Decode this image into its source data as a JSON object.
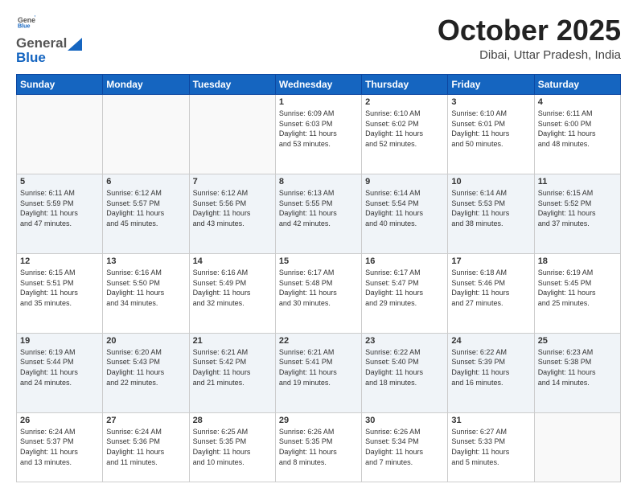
{
  "header": {
    "logo_general": "General",
    "logo_blue": "Blue",
    "month_title": "October 2025",
    "location": "Dibai, Uttar Pradesh, India"
  },
  "days_of_week": [
    "Sunday",
    "Monday",
    "Tuesday",
    "Wednesday",
    "Thursday",
    "Friday",
    "Saturday"
  ],
  "weeks": [
    {
      "alt": false,
      "cells": [
        {
          "day": "",
          "info": ""
        },
        {
          "day": "",
          "info": ""
        },
        {
          "day": "",
          "info": ""
        },
        {
          "day": "1",
          "info": "Sunrise: 6:09 AM\nSunset: 6:03 PM\nDaylight: 11 hours\nand 53 minutes."
        },
        {
          "day": "2",
          "info": "Sunrise: 6:10 AM\nSunset: 6:02 PM\nDaylight: 11 hours\nand 52 minutes."
        },
        {
          "day": "3",
          "info": "Sunrise: 6:10 AM\nSunset: 6:01 PM\nDaylight: 11 hours\nand 50 minutes."
        },
        {
          "day": "4",
          "info": "Sunrise: 6:11 AM\nSunset: 6:00 PM\nDaylight: 11 hours\nand 48 minutes."
        }
      ]
    },
    {
      "alt": true,
      "cells": [
        {
          "day": "5",
          "info": "Sunrise: 6:11 AM\nSunset: 5:59 PM\nDaylight: 11 hours\nand 47 minutes."
        },
        {
          "day": "6",
          "info": "Sunrise: 6:12 AM\nSunset: 5:57 PM\nDaylight: 11 hours\nand 45 minutes."
        },
        {
          "day": "7",
          "info": "Sunrise: 6:12 AM\nSunset: 5:56 PM\nDaylight: 11 hours\nand 43 minutes."
        },
        {
          "day": "8",
          "info": "Sunrise: 6:13 AM\nSunset: 5:55 PM\nDaylight: 11 hours\nand 42 minutes."
        },
        {
          "day": "9",
          "info": "Sunrise: 6:14 AM\nSunset: 5:54 PM\nDaylight: 11 hours\nand 40 minutes."
        },
        {
          "day": "10",
          "info": "Sunrise: 6:14 AM\nSunset: 5:53 PM\nDaylight: 11 hours\nand 38 minutes."
        },
        {
          "day": "11",
          "info": "Sunrise: 6:15 AM\nSunset: 5:52 PM\nDaylight: 11 hours\nand 37 minutes."
        }
      ]
    },
    {
      "alt": false,
      "cells": [
        {
          "day": "12",
          "info": "Sunrise: 6:15 AM\nSunset: 5:51 PM\nDaylight: 11 hours\nand 35 minutes."
        },
        {
          "day": "13",
          "info": "Sunrise: 6:16 AM\nSunset: 5:50 PM\nDaylight: 11 hours\nand 34 minutes."
        },
        {
          "day": "14",
          "info": "Sunrise: 6:16 AM\nSunset: 5:49 PM\nDaylight: 11 hours\nand 32 minutes."
        },
        {
          "day": "15",
          "info": "Sunrise: 6:17 AM\nSunset: 5:48 PM\nDaylight: 11 hours\nand 30 minutes."
        },
        {
          "day": "16",
          "info": "Sunrise: 6:17 AM\nSunset: 5:47 PM\nDaylight: 11 hours\nand 29 minutes."
        },
        {
          "day": "17",
          "info": "Sunrise: 6:18 AM\nSunset: 5:46 PM\nDaylight: 11 hours\nand 27 minutes."
        },
        {
          "day": "18",
          "info": "Sunrise: 6:19 AM\nSunset: 5:45 PM\nDaylight: 11 hours\nand 25 minutes."
        }
      ]
    },
    {
      "alt": true,
      "cells": [
        {
          "day": "19",
          "info": "Sunrise: 6:19 AM\nSunset: 5:44 PM\nDaylight: 11 hours\nand 24 minutes."
        },
        {
          "day": "20",
          "info": "Sunrise: 6:20 AM\nSunset: 5:43 PM\nDaylight: 11 hours\nand 22 minutes."
        },
        {
          "day": "21",
          "info": "Sunrise: 6:21 AM\nSunset: 5:42 PM\nDaylight: 11 hours\nand 21 minutes."
        },
        {
          "day": "22",
          "info": "Sunrise: 6:21 AM\nSunset: 5:41 PM\nDaylight: 11 hours\nand 19 minutes."
        },
        {
          "day": "23",
          "info": "Sunrise: 6:22 AM\nSunset: 5:40 PM\nDaylight: 11 hours\nand 18 minutes."
        },
        {
          "day": "24",
          "info": "Sunrise: 6:22 AM\nSunset: 5:39 PM\nDaylight: 11 hours\nand 16 minutes."
        },
        {
          "day": "25",
          "info": "Sunrise: 6:23 AM\nSunset: 5:38 PM\nDaylight: 11 hours\nand 14 minutes."
        }
      ]
    },
    {
      "alt": false,
      "cells": [
        {
          "day": "26",
          "info": "Sunrise: 6:24 AM\nSunset: 5:37 PM\nDaylight: 11 hours\nand 13 minutes."
        },
        {
          "day": "27",
          "info": "Sunrise: 6:24 AM\nSunset: 5:36 PM\nDaylight: 11 hours\nand 11 minutes."
        },
        {
          "day": "28",
          "info": "Sunrise: 6:25 AM\nSunset: 5:35 PM\nDaylight: 11 hours\nand 10 minutes."
        },
        {
          "day": "29",
          "info": "Sunrise: 6:26 AM\nSunset: 5:35 PM\nDaylight: 11 hours\nand 8 minutes."
        },
        {
          "day": "30",
          "info": "Sunrise: 6:26 AM\nSunset: 5:34 PM\nDaylight: 11 hours\nand 7 minutes."
        },
        {
          "day": "31",
          "info": "Sunrise: 6:27 AM\nSunset: 5:33 PM\nDaylight: 11 hours\nand 5 minutes."
        },
        {
          "day": "",
          "info": ""
        }
      ]
    }
  ]
}
